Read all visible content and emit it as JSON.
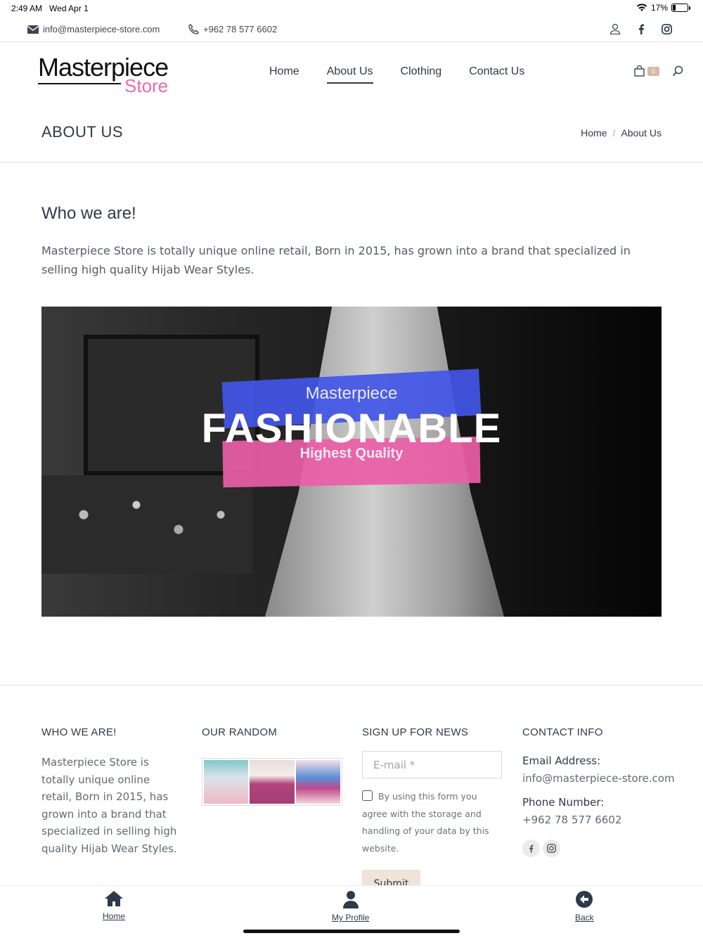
{
  "status_bar": {
    "time": "2:49 AM",
    "date": "Wed Apr 1",
    "battery": "17%"
  },
  "topbar": {
    "email": "info@masterpiece-store.com",
    "phone": "+962 78 577 6602"
  },
  "logo": {
    "line1": "Masterpiece",
    "line2": "Store"
  },
  "nav": {
    "items": [
      "Home",
      "About Us",
      "Clothing",
      "Contact Us"
    ],
    "active": "About Us"
  },
  "cart": {
    "count": "0"
  },
  "page": {
    "title": "ABOUT US",
    "breadcrumb": [
      "Home",
      "About Us"
    ]
  },
  "content": {
    "heading": "Who we are!",
    "body": "Masterpiece Store is totally unique online retail, Born in 2015, has grown into a brand that specialized in selling high quality Hijab Wear Styles."
  },
  "banner": {
    "line1": "Masterpiece",
    "line2": "FASHIONABLE",
    "line3": "Highest Quality",
    "accent_blue": "#4256e6",
    "accent_pink": "#ea5ea8"
  },
  "footer": {
    "col1": {
      "title": "WHO WE ARE!",
      "text": "Masterpiece Store is totally unique online retail, Born in 2015, has grown into a brand that specialized in selling high quality Hijab Wear Styles."
    },
    "col2": {
      "title": "OUR RANDOM"
    },
    "col3": {
      "title": "SIGN UP FOR NEWS",
      "email_placeholder": "E-mail *",
      "consent": "By using this form you agree with the storage and handling of your data by this website.",
      "submit": "Submit"
    },
    "col4": {
      "title": "CONTACT INFO",
      "email_label": "Email Address:",
      "email": "info@masterpiece-store.com",
      "phone_label": "Phone Number:",
      "phone": "+962 78 577 6602"
    }
  },
  "tabbar": {
    "home": "Home",
    "profile": "My Profile",
    "back": "Back"
  }
}
